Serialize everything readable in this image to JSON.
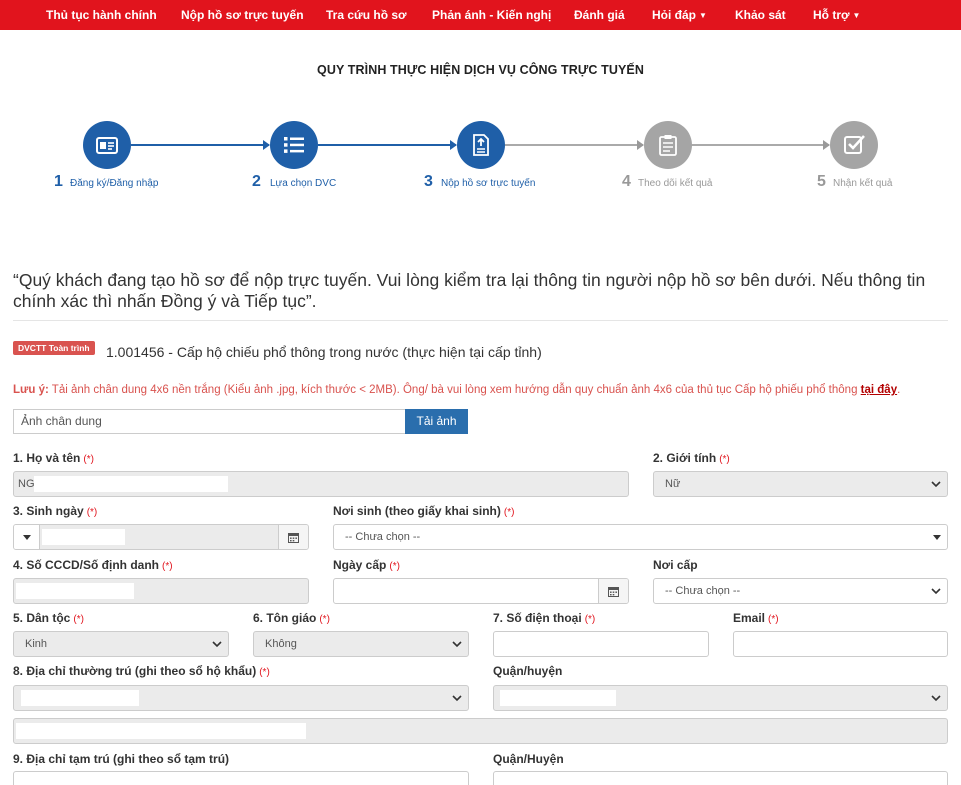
{
  "nav": {
    "items": [
      "Thủ tục hành chính",
      "Nộp hồ sơ trực tuyến",
      "Tra cứu hồ sơ",
      "Phản ánh - Kiến nghị",
      "Đánh giá",
      "Hỏi đáp",
      "Khảo sát",
      "Hỗ trợ"
    ],
    "caret": "▼"
  },
  "page_title": "QUY TRÌNH THỰC HIỆN DỊCH VỤ CÔNG TRỰC TUYẾN",
  "steps": [
    {
      "num": "1",
      "label": "Đăng ký/Đăng nhập",
      "icon": "id-card-icon",
      "state": "done"
    },
    {
      "num": "2",
      "label": "Lựa chọn DVC",
      "icon": "list-icon",
      "state": "done"
    },
    {
      "num": "3",
      "label": "Nộp hồ sơ trực tuyến",
      "icon": "document-upload-icon",
      "state": "current"
    },
    {
      "num": "4",
      "label": "Theo dõi kết quả",
      "icon": "clipboard-icon",
      "state": "pending"
    },
    {
      "num": "5",
      "label": "Nhận kết quả",
      "icon": "check-square-icon",
      "state": "pending"
    }
  ],
  "colors": {
    "nav": "#e1141d",
    "active": "#1f5fa8",
    "inactive": "#999999"
  },
  "notice": "“Quý khách đang tạo hồ sơ để nộp trực tuyến. Vui lòng kiểm tra lại thông tin người nộp hồ sơ bên dưới. Nếu thông tin chính xác thì nhấn Đồng ý và Tiếp tục”.",
  "procedure": {
    "badge": "DVCTT Toàn trình",
    "name": "1.001456 - Cấp hộ chiếu phổ thông trong nước (thực hiện tại cấp tỉnh)"
  },
  "warning": {
    "prefix": "Lưu ý:",
    "text": " Tải ảnh chân dung 4x6 nền trắng (Kiểu ảnh .jpg, kích thước < 2MB). Ông/ bà vui lòng xem hướng dẫn quy chuẩn ảnh 4x6 của thủ tục Cấp hộ phiếu phổ thông ",
    "link": "tại đây",
    "end": "."
  },
  "photo": {
    "placeholder": "Ảnh chân dung",
    "button": "Tải ảnh"
  },
  "required_mark": "(*)",
  "form": {
    "ho_ten": {
      "label": "1. Họ và tên",
      "value": "NG"
    },
    "gioi_tinh": {
      "label": "2. Giới tính",
      "value": "Nữ"
    },
    "sinh_ngay": {
      "label": "3. Sinh ngày"
    },
    "noi_sinh": {
      "label": "Nơi sinh (theo giấy khai sinh)",
      "value": "-- Chưa chọn --"
    },
    "cccd": {
      "label": "4. Số CCCD/Số định danh"
    },
    "ngay_cap": {
      "label": "Ngày cấp"
    },
    "noi_cap": {
      "label": "Nơi cấp",
      "value": "-- Chưa chọn --"
    },
    "dan_toc": {
      "label": "5. Dân tộc",
      "value": "Kinh"
    },
    "ton_giao": {
      "label": "6. Tôn giáo",
      "value": "Không"
    },
    "dien_thoai": {
      "label": "7. Số điện thoại"
    },
    "email": {
      "label": "Email"
    },
    "dia_chi_tt": {
      "label": "8. Địa chỉ thường trú (ghi theo sổ hộ khẩu)"
    },
    "quan_huyen_tt": {
      "label": "Quận/huyện"
    },
    "dia_chi_tamtru": {
      "label": "9. Địa chỉ tạm trú (ghi theo sổ tạm trú)"
    },
    "quan_huyen_tamtru": {
      "label": "Quận/Huyện"
    }
  }
}
